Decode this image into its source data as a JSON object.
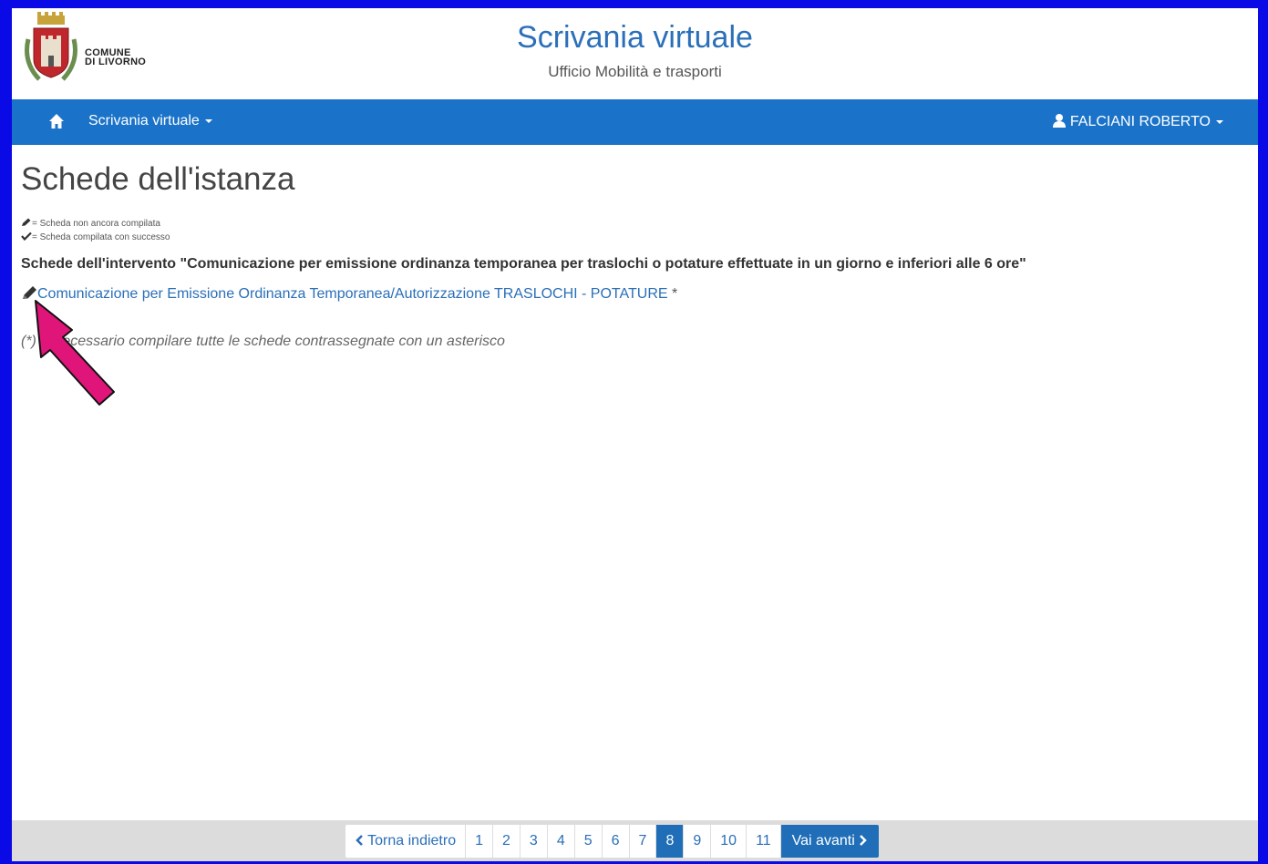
{
  "header": {
    "logo_line1": "COMUNE",
    "logo_line2": "DI LIVORNO",
    "title": "Scrivania virtuale",
    "subtitle": "Ufficio Mobilità e trasporti"
  },
  "navbar": {
    "home_icon": "home-icon",
    "menu_label": "Scrivania virtuale",
    "user_label": "FALCIANI ROBERTO",
    "color": "#1a73c8"
  },
  "main": {
    "title": "Schede dell'istanza",
    "legend": [
      {
        "icon": "pencil-icon",
        "text": "= Scheda non ancora compilata"
      },
      {
        "icon": "check-icon",
        "text": "= Scheda compilata con successo"
      }
    ],
    "section_heading": "Schede dell'intervento \"Comunicazione per emissione ordinanza temporanea per traslochi o potature effettuate in un giorno e inferiori alle 6 ore\"",
    "form_link": "Comunicazione per Emissione Ordinanza Temporanea/Autorizzazione TRASLOCHI - POTATURE",
    "form_link_suffix": " *",
    "note": "(*) È necessario compilare tutte le schede contrassegnate con un asterisco",
    "annotation_color": "#e0157a"
  },
  "pagination": {
    "prev_label": "Torna indietro",
    "pages": [
      "1",
      "2",
      "3",
      "4",
      "5",
      "6",
      "7",
      "8",
      "9",
      "10",
      "11"
    ],
    "active_page": "8",
    "next_label": "Vai avanti"
  }
}
